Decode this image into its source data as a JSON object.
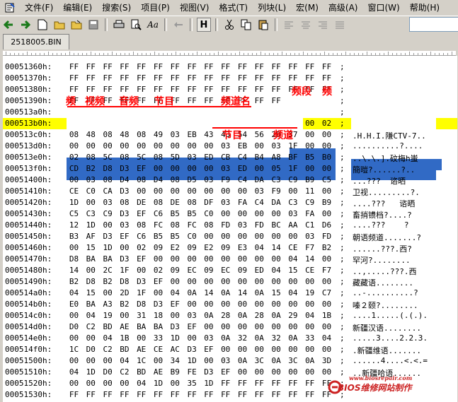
{
  "menu": [
    "文件(F)",
    "编辑(E)",
    "搜索(S)",
    "项目(P)",
    "视图(V)",
    "格式(T)",
    "列块(L)",
    "宏(M)",
    "高级(A)",
    "窗口(W)",
    "帮助(H)"
  ],
  "toolbar": {
    "hex_mode_label": "H",
    "font_label": "Aa"
  },
  "tab": {
    "filename": "2518005.BIN"
  },
  "rows": [
    {
      "addr": "00051360h:",
      "bytes": [
        "FF",
        "FF",
        "FF",
        "FF",
        "FF",
        "FF",
        "FF",
        "FF",
        "FF",
        "FF",
        "FF",
        "FF",
        "FF",
        "FF",
        "FF",
        "FF"
      ],
      "ascii": ""
    },
    {
      "addr": "00051370h:",
      "bytes": [
        "FF",
        "FF",
        "FF",
        "FF",
        "FF",
        "FF",
        "FF",
        "FF",
        "FF",
        "FF",
        "FF",
        "FF",
        "FF",
        "FF",
        "FF",
        "FF"
      ],
      "ascii": ""
    },
    {
      "addr": "00051380h:",
      "bytes": [
        "FF",
        "FF",
        "FF",
        "FF",
        "FF",
        "FF",
        "FF",
        "FF",
        "FF",
        "FF",
        "FF",
        "FF",
        "FF",
        "FF",
        "FF",
        "FF"
      ],
      "ascii": ""
    },
    {
      "addr": "00051390h:",
      "bytes": [
        "FF",
        "FF",
        "FF",
        "FF",
        "FF",
        "FF",
        "FF",
        "FF",
        "FF",
        "FF",
        "FF",
        "FF",
        "FF",
        "00",
        "02",
        "08"
      ],
      "ascii": ""
    },
    {
      "addr": "000513a0h:",
      "bytes": [
        "34",
        "08",
        "34",
        "08",
        "35",
        "03",
        "E9",
        "43",
        "43",
        "54",
        "56",
        "2D",
        "31",
        "00",
        "00",
        "00"
      ],
      "ascii": "4.4.5.镃CTV-1..."
    },
    {
      "addr": "000513b0h:",
      "bytes": [
        "00",
        "00",
        "00",
        "00",
        "00",
        "00",
        "00",
        "00",
        "00",
        "03",
        "E9",
        "00",
        "01",
        "1F",
        "00",
        "02"
      ],
      "ascii": "..........?...."
    },
    {
      "addr": "000513c0h:",
      "bytes": [
        "08",
        "48",
        "08",
        "48",
        "08",
        "49",
        "03",
        "EB",
        "43",
        "43",
        "54",
        "56",
        "2D",
        "37",
        "00",
        "00"
      ],
      "ascii": ".H.H.I.隒CTV-7.."
    },
    {
      "addr": "000513d0h:",
      "bytes": [
        "00",
        "00",
        "00",
        "00",
        "00",
        "00",
        "00",
        "00",
        "00",
        "03",
        "EB",
        "00",
        "03",
        "1F",
        "00",
        "00"
      ],
      "ascii": "..........?...."
    },
    {
      "addr": "000513e0h:",
      "bytes": [
        "02",
        "08",
        "5C",
        "08",
        "5C",
        "08",
        "5D",
        "03",
        "ED",
        "CB",
        "C4",
        "B4",
        "A8",
        "BF",
        "B5",
        "B0"
      ],
      "ascii": "..\\.\\.].砇梅h蚩"
    },
    {
      "addr": "000513f0h:",
      "bytes": [
        "CD",
        "B2",
        "D8",
        "D3",
        "EF",
        "00",
        "00",
        "00",
        "00",
        "03",
        "ED",
        "00",
        "05",
        "1F",
        "00",
        "00"
      ],
      "ascii": "簡暟?......?.."
    },
    {
      "addr": "00051400h:",
      "bytes": [
        "00",
        "03",
        "08",
        "D4",
        "08",
        "D4",
        "08",
        "D5",
        "03",
        "F9",
        "C4",
        "DA",
        "C3",
        "C9",
        "B9",
        "C5"
      ],
      "ascii": "...???  谘晒"
    },
    {
      "addr": "00051410h:",
      "bytes": [
        "CE",
        "C0",
        "CA",
        "D3",
        "00",
        "00",
        "00",
        "00",
        "00",
        "00",
        "00",
        "03",
        "F9",
        "00",
        "11",
        "00"
      ],
      "ascii": "卫视.........?."
    },
    {
      "addr": "00051420h:",
      "bytes": [
        "1D",
        "00",
        "03",
        "08",
        "DE",
        "08",
        "DE",
        "08",
        "DF",
        "03",
        "FA",
        "C4",
        "DA",
        "C3",
        "C9",
        "B9"
      ],
      "ascii": "....???   谘晒"
    },
    {
      "addr": "00051430h:",
      "bytes": [
        "C5",
        "C3",
        "C9",
        "D3",
        "EF",
        "C6",
        "B5",
        "B5",
        "C0",
        "00",
        "00",
        "00",
        "00",
        "03",
        "FA",
        "00"
      ],
      "ascii": "畜捎镄档?....?"
    },
    {
      "addr": "00051440h:",
      "bytes": [
        "12",
        "1D",
        "00",
        "03",
        "08",
        "FC",
        "08",
        "FC",
        "08",
        "FD",
        "03",
        "FD",
        "BC",
        "AA",
        "C1",
        "D6"
      ],
      "ascii": "....???    ?"
    },
    {
      "addr": "00051450h:",
      "bytes": [
        "B3",
        "AF",
        "D3",
        "EF",
        "C6",
        "B5",
        "B5",
        "C0",
        "00",
        "00",
        "00",
        "00",
        "00",
        "00",
        "03",
        "FD"
      ],
      "ascii": "朝语频道.......?"
    },
    {
      "addr": "00051460h:",
      "bytes": [
        "00",
        "15",
        "1D",
        "00",
        "02",
        "09",
        "E2",
        "09",
        "E2",
        "09",
        "E3",
        "04",
        "14",
        "CE",
        "F7",
        "B2"
      ],
      "ascii": "......???.西?"
    },
    {
      "addr": "00051470h:",
      "bytes": [
        "D8",
        "BA",
        "BA",
        "D3",
        "EF",
        "00",
        "00",
        "00",
        "00",
        "00",
        "00",
        "00",
        "00",
        "04",
        "14",
        "00"
      ],
      "ascii": "罕河?........"
    },
    {
      "addr": "00051480h:",
      "bytes": [
        "14",
        "00",
        "2C",
        "1F",
        "00",
        "02",
        "09",
        "EC",
        "09",
        "EC",
        "09",
        "ED",
        "04",
        "15",
        "CE",
        "F7"
      ],
      "ascii": "..,.....???.西"
    },
    {
      "addr": "00051490h:",
      "bytes": [
        "B2",
        "D8",
        "B2",
        "D8",
        "D3",
        "EF",
        "00",
        "00",
        "00",
        "00",
        "00",
        "00",
        "00",
        "00",
        "00",
        "00"
      ],
      "ascii": "藏藏语........"
    },
    {
      "addr": "000514a0h:",
      "bytes": [
        "04",
        "15",
        "00",
        "2D",
        "1F",
        "00",
        "04",
        "0A",
        "14",
        "0A",
        "14",
        "0A",
        "15",
        "04",
        "19",
        "C7"
      ],
      "ascii": "..-..........?"
    },
    {
      "addr": "000514b0h:",
      "bytes": [
        "E0",
        "BA",
        "A3",
        "B2",
        "D8",
        "D3",
        "EF",
        "00",
        "00",
        "00",
        "00",
        "00",
        "00",
        "00",
        "00",
        "00"
      ],
      "ascii": "嗪２颐?........"
    },
    {
      "addr": "000514c0h:",
      "bytes": [
        "00",
        "04",
        "19",
        "00",
        "31",
        "18",
        "00",
        "03",
        "0A",
        "28",
        "0A",
        "28",
        "0A",
        "29",
        "04",
        "1B"
      ],
      "ascii": "....1.....(.(.)."
    },
    {
      "addr": "000514d0h:",
      "bytes": [
        "D0",
        "C2",
        "BD",
        "AE",
        "BA",
        "BA",
        "D3",
        "EF",
        "00",
        "00",
        "00",
        "00",
        "00",
        "00",
        "00",
        "00"
      ],
      "ascii": "新疆汉语........"
    },
    {
      "addr": "000514e0h:",
      "bytes": [
        "00",
        "00",
        "04",
        "1B",
        "00",
        "33",
        "1D",
        "00",
        "03",
        "0A",
        "32",
        "0A",
        "32",
        "0A",
        "33",
        "04"
      ],
      "ascii": ".....3....2.2.3."
    },
    {
      "addr": "000514f0h:",
      "bytes": [
        "1C",
        "D0",
        "C2",
        "BD",
        "AE",
        "CE",
        "AC",
        "D3",
        "EF",
        "00",
        "00",
        "00",
        "00",
        "00",
        "00",
        "00"
      ],
      "ascii": ".新疆维语......."
    },
    {
      "addr": "00051500h:",
      "bytes": [
        "00",
        "00",
        "00",
        "04",
        "1C",
        "00",
        "34",
        "1D",
        "00",
        "03",
        "0A",
        "3C",
        "0A",
        "3C",
        "0A",
        "3D"
      ],
      "ascii": "......4....<.<.="
    },
    {
      "addr": "00051510h:",
      "bytes": [
        "04",
        "1D",
        "D0",
        "C2",
        "BD",
        "AE",
        "B9",
        "FE",
        "D3",
        "EF",
        "00",
        "00",
        "00",
        "00",
        "00",
        "00"
      ],
      "ascii": "..新疆哈语......"
    },
    {
      "addr": "00051520h:",
      "bytes": [
        "00",
        "00",
        "00",
        "00",
        "04",
        "1D",
        "00",
        "35",
        "1D",
        "FF",
        "FF",
        "FF",
        "FF",
        "FF",
        "FF",
        "FF"
      ],
      "ascii": ""
    },
    {
      "addr": "00051530h:",
      "bytes": [
        "FF",
        "FF",
        "FF",
        "FF",
        "FF",
        "FF",
        "FF",
        "FF",
        "FF",
        "FF",
        "FF",
        "FF",
        "FF",
        "FF",
        "FF",
        "FF"
      ],
      "ascii": ""
    }
  ],
  "annotations": {
    "top_row": [
      "频",
      "视频",
      "音频",
      "节目",
      "频道名"
    ],
    "top_right": [
      "频段",
      "频"
    ],
    "below": [
      "节目",
      "频道"
    ]
  },
  "watermark": {
    "url": "www.biosrepair.com",
    "text": "BIOS维修网站制作"
  },
  "colors": {
    "selection": "#316ac5",
    "current_line": "#ffff00",
    "annotation": "#ff0000",
    "watermark": "#cc2222"
  }
}
